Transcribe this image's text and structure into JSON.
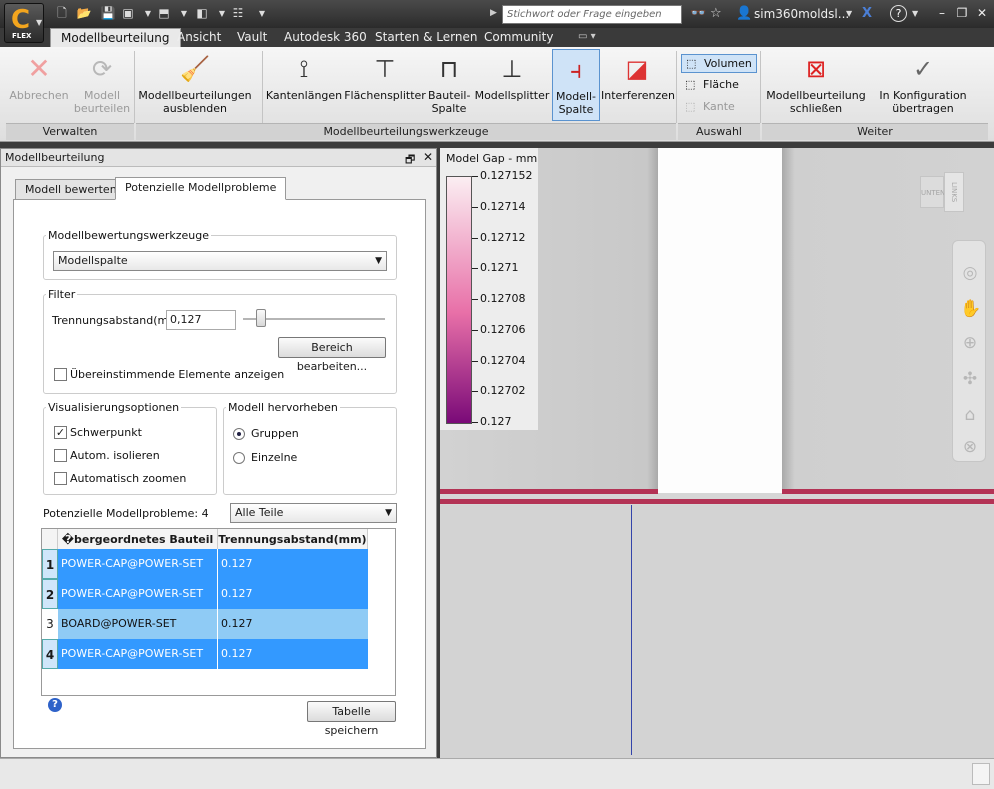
{
  "app": {
    "logo_letter": "C",
    "logo_sub": "FLEX",
    "search_placeholder": "Stichwort oder Frage eingeben",
    "user": "sim360moldsl...",
    "help": "?"
  },
  "ribbon": {
    "tabs": [
      {
        "label": "Modellbeurteilung"
      },
      {
        "label": "Ansicht"
      },
      {
        "label": "Vault"
      },
      {
        "label": "Autodesk 360"
      },
      {
        "label": "Starten & Lernen"
      },
      {
        "label": "Community"
      }
    ],
    "groups": {
      "verwalten": "Verwalten",
      "werkzeuge": "Modellbeurteilungswerkzeuge",
      "auswahl": "Auswahl",
      "weiter": "Weiter"
    },
    "buttons": {
      "abbrechen": "Abbrechen",
      "modell": "Modell",
      "beurteilen": "beurteilen",
      "ausblenden1": "Modellbeurteilungen",
      "ausblenden2": "ausblenden",
      "kanten": "Kantenlängen",
      "flaechen": "Flächensplitter",
      "bauteil1": "Bauteil-",
      "bauteil2": "Spalte",
      "modellsplitter": "Modellsplitter",
      "modellspalte1": "Modell-",
      "modellspalte2": "Spalte",
      "interferenzen": "Interferenzen",
      "volumen": "Volumen",
      "flaeche": "Fläche",
      "kante": "Kante",
      "schliessen1": "Modellbeurteilung",
      "schliessen2": "schließen",
      "konfig1": "In Konfiguration",
      "konfig2": "übertragen"
    }
  },
  "panel": {
    "title": "Modellbeurteilung",
    "tabs": [
      "Modell bewerten",
      "Potenzielle Modellprobleme"
    ],
    "tools_legend": "Modellbewertungswerkzeuge",
    "tools_value": "Modellspalte",
    "filter_legend": "Filter",
    "sep_label": "Trennungsabstand(mm)",
    "sep_value": "0,127",
    "slider_fraction": 0.1,
    "range_button": "Bereich bearbeiten...",
    "matching_label": "Übereinstimmende Elemente anzeigen",
    "vis_legend": "Visualisierungsoptionen",
    "vis": [
      {
        "label": "Schwerpunkt",
        "checked": true
      },
      {
        "label": "Autom. isolieren",
        "checked": false
      },
      {
        "label": "Automatisch zoomen",
        "checked": false
      }
    ],
    "highlight_legend": "Modell hervorheben",
    "highlight": [
      {
        "label": "Gruppen",
        "selected": true
      },
      {
        "label": "Einzelne",
        "selected": false
      }
    ],
    "problems_label": "Potenzielle Modellprobleme: 4",
    "parts_filter": "Alle Teile",
    "table": {
      "headers": [
        "�bergeordnetes Bauteil",
        "Trennungsabstand(mm)"
      ],
      "rows": [
        {
          "num": "1",
          "part": "POWER-CAP@POWER-SET",
          "gap": "0.127"
        },
        {
          "num": "2",
          "part": "POWER-CAP@POWER-SET",
          "gap": "0.127"
        },
        {
          "num": "3",
          "part": "BOARD@POWER-SET",
          "gap": "0.127"
        },
        {
          "num": "4",
          "part": "POWER-CAP@POWER-SET",
          "gap": "0.127"
        }
      ]
    },
    "save_button": "Tabelle speichern"
  },
  "viewport": {
    "legend_title": "Model Gap - mm",
    "legend_ticks": [
      "0.127152",
      "0.12714",
      "0.12712",
      "0.1271",
      "0.12708",
      "0.12706",
      "0.12704",
      "0.12702",
      "0.127"
    ],
    "legend_colors": [
      "#fbeef2",
      "#7a0a78"
    ],
    "viewcube": {
      "top": "UNTEN",
      "side": "LINKS"
    }
  },
  "colors": {
    "selection": "#3399ff",
    "selection_light": "#8fcbf5",
    "gap_line": "#b33355"
  }
}
